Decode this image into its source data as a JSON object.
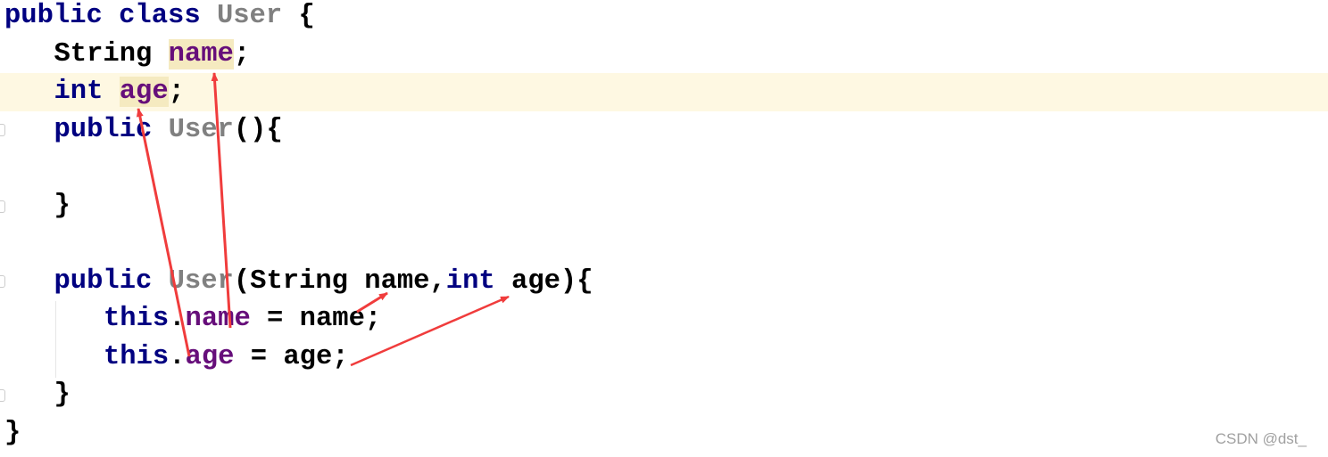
{
  "colors": {
    "keyword": "#000080",
    "class_name": "#808080",
    "field": "#660e7a",
    "plain": "#000000",
    "arrow": "#f03c3c",
    "current_line": "#fef8e2",
    "highlight": "#f5eac0"
  },
  "code_lines": [
    {
      "indent": 0,
      "tokens": [
        {
          "t": "public class ",
          "k": "kw"
        },
        {
          "t": "User",
          "k": "cls"
        },
        {
          "t": " {",
          "k": "plain"
        }
      ]
    },
    {
      "indent": 1,
      "tokens": [
        {
          "t": "String ",
          "k": "plain"
        },
        {
          "t": "name",
          "k": "fld",
          "hl": true
        },
        {
          "t": ";",
          "k": "plain"
        }
      ]
    },
    {
      "indent": 1,
      "current": true,
      "tokens": [
        {
          "t": "int ",
          "k": "kw"
        },
        {
          "t": "age",
          "k": "fld",
          "hl": true
        },
        {
          "t": ";",
          "k": "plain"
        }
      ]
    },
    {
      "indent": 1,
      "tokens": [
        {
          "t": "public ",
          "k": "kw"
        },
        {
          "t": "User",
          "k": "cls"
        },
        {
          "t": "(){",
          "k": "plain"
        }
      ]
    },
    {
      "indent": 0,
      "tokens": []
    },
    {
      "indent": 1,
      "tokens": [
        {
          "t": "}",
          "k": "plain"
        }
      ]
    },
    {
      "indent": 0,
      "tokens": []
    },
    {
      "indent": 1,
      "tokens": [
        {
          "t": "public ",
          "k": "kw"
        },
        {
          "t": "User",
          "k": "cls"
        },
        {
          "t": "(String name,",
          "k": "plain"
        },
        {
          "t": "int ",
          "k": "kw"
        },
        {
          "t": "age){",
          "k": "plain"
        }
      ]
    },
    {
      "indent": 2,
      "tokens": [
        {
          "t": "this",
          "k": "kw"
        },
        {
          "t": ".",
          "k": "plain"
        },
        {
          "t": "name",
          "k": "fld"
        },
        {
          "t": " = name;",
          "k": "plain"
        }
      ]
    },
    {
      "indent": 2,
      "tokens": [
        {
          "t": "this",
          "k": "kw"
        },
        {
          "t": ".",
          "k": "plain"
        },
        {
          "t": "age",
          "k": "fld"
        },
        {
          "t": " = age;",
          "k": "plain"
        }
      ]
    },
    {
      "indent": 1,
      "tokens": [
        {
          "t": "}",
          "k": "plain"
        }
      ]
    },
    {
      "indent": 0,
      "tokens": [
        {
          "t": "}",
          "k": "plain"
        }
      ]
    }
  ],
  "watermark": "CSDN @dst_"
}
